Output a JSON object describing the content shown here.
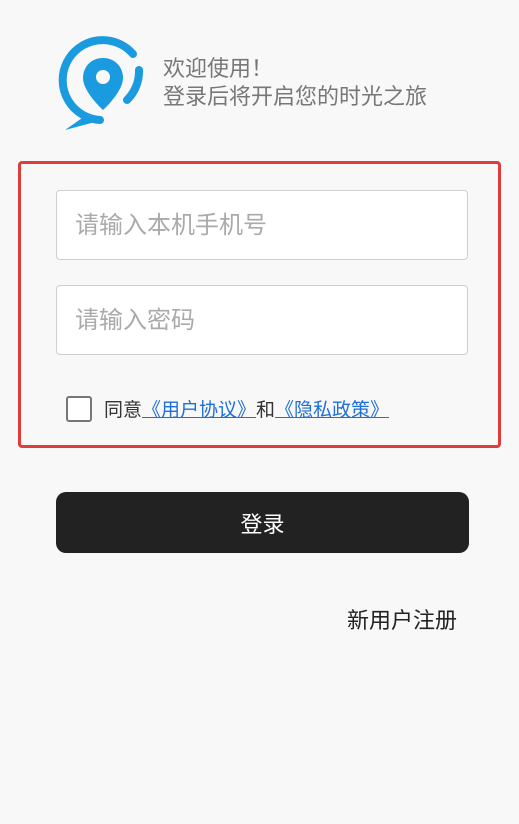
{
  "header": {
    "welcome_line1": "欢迎使用！",
    "welcome_line2": "登录后将开启您的时光之旅",
    "logo_icon": "location-chat-bubble-icon",
    "logo_color": "#1a9be0"
  },
  "form": {
    "phone_placeholder": "请输入本机手机号",
    "phone_value": "",
    "password_placeholder": "请输入密码",
    "password_value": "",
    "agree_checked": false,
    "agree_prefix": "同意",
    "user_agreement_link": "《用户协议》",
    "agree_and": "和",
    "privacy_policy_link": "《隐私政策》",
    "highlight_color": "#e23b3b"
  },
  "actions": {
    "login_label": "登录",
    "register_label": "新用户注册"
  }
}
